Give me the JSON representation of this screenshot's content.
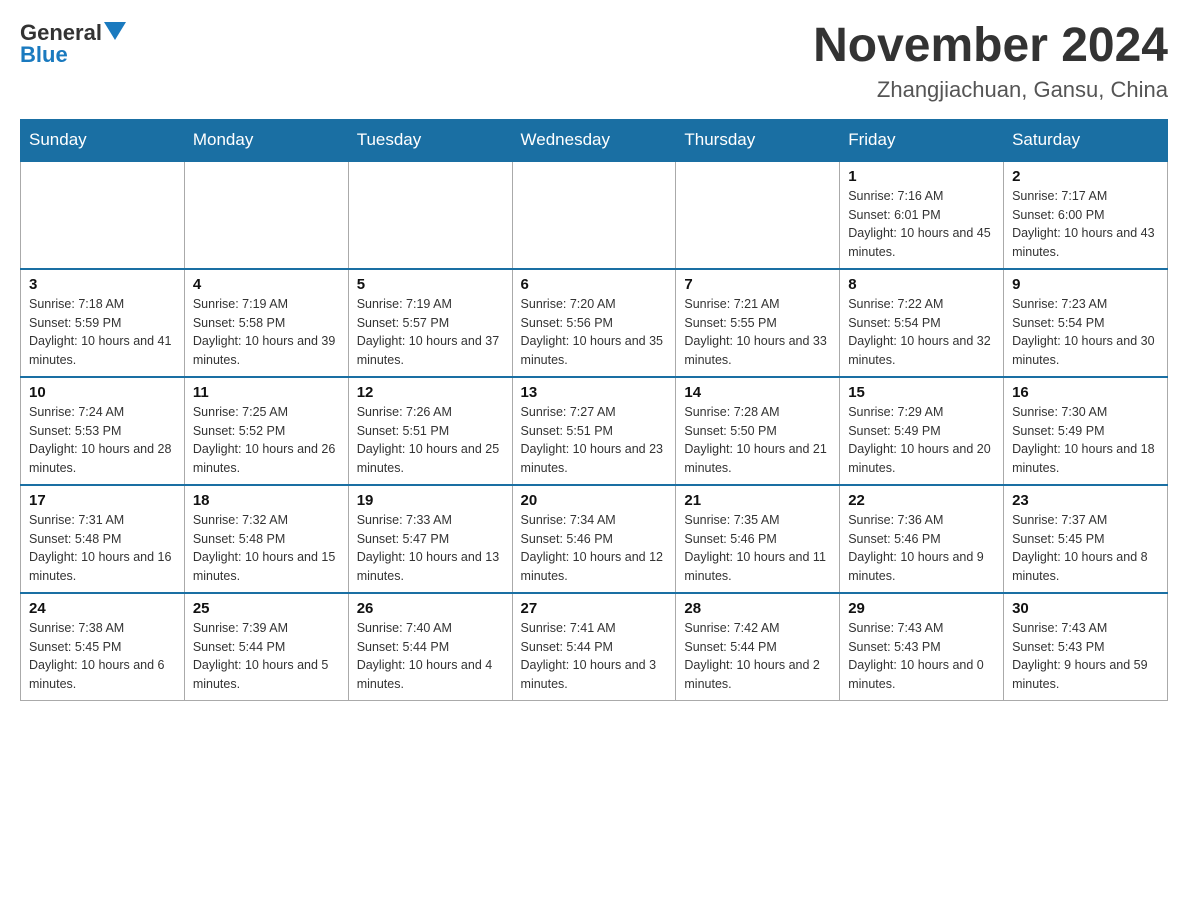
{
  "logo": {
    "text_general": "General",
    "text_blue": "Blue"
  },
  "header": {
    "month_year": "November 2024",
    "location": "Zhangjiachuan, Gansu, China"
  },
  "weekdays": [
    "Sunday",
    "Monday",
    "Tuesday",
    "Wednesday",
    "Thursday",
    "Friday",
    "Saturday"
  ],
  "weeks": [
    [
      {
        "day": "",
        "info": ""
      },
      {
        "day": "",
        "info": ""
      },
      {
        "day": "",
        "info": ""
      },
      {
        "day": "",
        "info": ""
      },
      {
        "day": "",
        "info": ""
      },
      {
        "day": "1",
        "info": "Sunrise: 7:16 AM\nSunset: 6:01 PM\nDaylight: 10 hours and 45 minutes."
      },
      {
        "day": "2",
        "info": "Sunrise: 7:17 AM\nSunset: 6:00 PM\nDaylight: 10 hours and 43 minutes."
      }
    ],
    [
      {
        "day": "3",
        "info": "Sunrise: 7:18 AM\nSunset: 5:59 PM\nDaylight: 10 hours and 41 minutes."
      },
      {
        "day": "4",
        "info": "Sunrise: 7:19 AM\nSunset: 5:58 PM\nDaylight: 10 hours and 39 minutes."
      },
      {
        "day": "5",
        "info": "Sunrise: 7:19 AM\nSunset: 5:57 PM\nDaylight: 10 hours and 37 minutes."
      },
      {
        "day": "6",
        "info": "Sunrise: 7:20 AM\nSunset: 5:56 PM\nDaylight: 10 hours and 35 minutes."
      },
      {
        "day": "7",
        "info": "Sunrise: 7:21 AM\nSunset: 5:55 PM\nDaylight: 10 hours and 33 minutes."
      },
      {
        "day": "8",
        "info": "Sunrise: 7:22 AM\nSunset: 5:54 PM\nDaylight: 10 hours and 32 minutes."
      },
      {
        "day": "9",
        "info": "Sunrise: 7:23 AM\nSunset: 5:54 PM\nDaylight: 10 hours and 30 minutes."
      }
    ],
    [
      {
        "day": "10",
        "info": "Sunrise: 7:24 AM\nSunset: 5:53 PM\nDaylight: 10 hours and 28 minutes."
      },
      {
        "day": "11",
        "info": "Sunrise: 7:25 AM\nSunset: 5:52 PM\nDaylight: 10 hours and 26 minutes."
      },
      {
        "day": "12",
        "info": "Sunrise: 7:26 AM\nSunset: 5:51 PM\nDaylight: 10 hours and 25 minutes."
      },
      {
        "day": "13",
        "info": "Sunrise: 7:27 AM\nSunset: 5:51 PM\nDaylight: 10 hours and 23 minutes."
      },
      {
        "day": "14",
        "info": "Sunrise: 7:28 AM\nSunset: 5:50 PM\nDaylight: 10 hours and 21 minutes."
      },
      {
        "day": "15",
        "info": "Sunrise: 7:29 AM\nSunset: 5:49 PM\nDaylight: 10 hours and 20 minutes."
      },
      {
        "day": "16",
        "info": "Sunrise: 7:30 AM\nSunset: 5:49 PM\nDaylight: 10 hours and 18 minutes."
      }
    ],
    [
      {
        "day": "17",
        "info": "Sunrise: 7:31 AM\nSunset: 5:48 PM\nDaylight: 10 hours and 16 minutes."
      },
      {
        "day": "18",
        "info": "Sunrise: 7:32 AM\nSunset: 5:48 PM\nDaylight: 10 hours and 15 minutes."
      },
      {
        "day": "19",
        "info": "Sunrise: 7:33 AM\nSunset: 5:47 PM\nDaylight: 10 hours and 13 minutes."
      },
      {
        "day": "20",
        "info": "Sunrise: 7:34 AM\nSunset: 5:46 PM\nDaylight: 10 hours and 12 minutes."
      },
      {
        "day": "21",
        "info": "Sunrise: 7:35 AM\nSunset: 5:46 PM\nDaylight: 10 hours and 11 minutes."
      },
      {
        "day": "22",
        "info": "Sunrise: 7:36 AM\nSunset: 5:46 PM\nDaylight: 10 hours and 9 minutes."
      },
      {
        "day": "23",
        "info": "Sunrise: 7:37 AM\nSunset: 5:45 PM\nDaylight: 10 hours and 8 minutes."
      }
    ],
    [
      {
        "day": "24",
        "info": "Sunrise: 7:38 AM\nSunset: 5:45 PM\nDaylight: 10 hours and 6 minutes."
      },
      {
        "day": "25",
        "info": "Sunrise: 7:39 AM\nSunset: 5:44 PM\nDaylight: 10 hours and 5 minutes."
      },
      {
        "day": "26",
        "info": "Sunrise: 7:40 AM\nSunset: 5:44 PM\nDaylight: 10 hours and 4 minutes."
      },
      {
        "day": "27",
        "info": "Sunrise: 7:41 AM\nSunset: 5:44 PM\nDaylight: 10 hours and 3 minutes."
      },
      {
        "day": "28",
        "info": "Sunrise: 7:42 AM\nSunset: 5:44 PM\nDaylight: 10 hours and 2 minutes."
      },
      {
        "day": "29",
        "info": "Sunrise: 7:43 AM\nSunset: 5:43 PM\nDaylight: 10 hours and 0 minutes."
      },
      {
        "day": "30",
        "info": "Sunrise: 7:43 AM\nSunset: 5:43 PM\nDaylight: 9 hours and 59 minutes."
      }
    ]
  ]
}
